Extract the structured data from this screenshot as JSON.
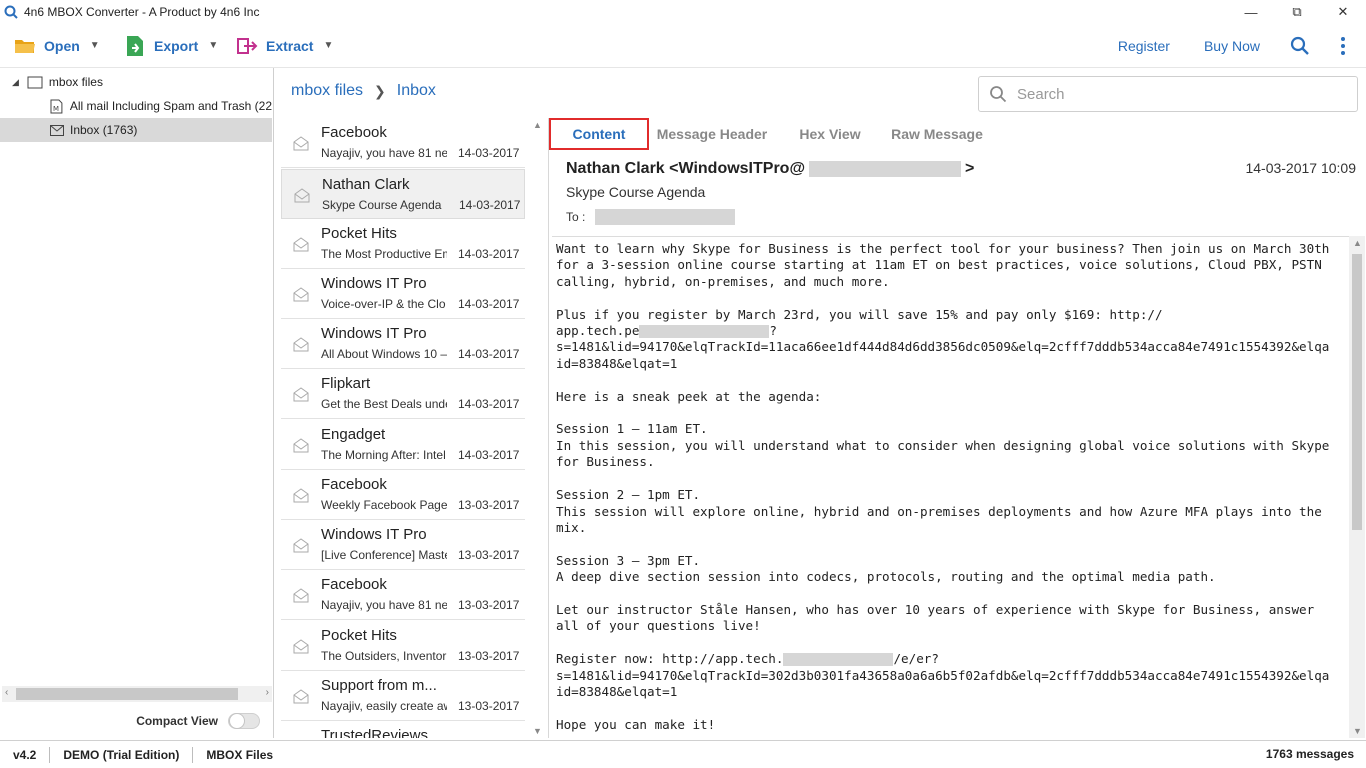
{
  "window": {
    "title": "4n6 MBOX Converter - A Product by 4n6 Inc",
    "app_icon": "magnifier-icon",
    "controls": {
      "minimize": "—",
      "restore": "⧉",
      "close": "✕"
    }
  },
  "toolbar": {
    "open_label": "Open",
    "export_label": "Export",
    "extract_label": "Extract",
    "register_label": "Register",
    "buy_label": "Buy Now"
  },
  "tree": {
    "root_label": "mbox files",
    "items": [
      {
        "label": "All mail Including Spam and Trash  (22",
        "icon": "mbox-file-icon"
      },
      {
        "label": "Inbox  (1763)",
        "icon": "envelope-icon",
        "selected": true
      }
    ]
  },
  "compact_view": {
    "label": "Compact View",
    "on": false
  },
  "breadcrumb": {
    "root": "mbox files",
    "current": "Inbox"
  },
  "search": {
    "placeholder": "Search"
  },
  "mails": [
    {
      "sender": "Facebook",
      "subject": "Nayajiv, you have 81 ne",
      "date": "14-03-2017"
    },
    {
      "sender": "Nathan Clark",
      "subject": "Skype Course Agenda",
      "date": "14-03-2017",
      "selected": true
    },
    {
      "sender": "Pocket Hits",
      "subject": "The Most Productive Em",
      "date": "14-03-2017"
    },
    {
      "sender": "Windows IT Pro",
      "subject": "Voice-over-IP & the Clo",
      "date": "14-03-2017"
    },
    {
      "sender": "Windows IT Pro",
      "subject": "All About Windows 10 –",
      "date": "14-03-2017"
    },
    {
      "sender": "Flipkart",
      "subject": "Get the Best Deals unde",
      "date": "14-03-2017"
    },
    {
      "sender": "Engadget",
      "subject": "The Morning After: Intel",
      "date": "14-03-2017"
    },
    {
      "sender": "Facebook",
      "subject": "Weekly Facebook Page (",
      "date": "13-03-2017"
    },
    {
      "sender": "Windows IT Pro",
      "subject": "[Live Conference] Maste",
      "date": "13-03-2017"
    },
    {
      "sender": "Facebook",
      "subject": "Nayajiv, you have 81 ne",
      "date": "13-03-2017"
    },
    {
      "sender": "Pocket Hits",
      "subject": "The Outsiders, Inventor",
      "date": "13-03-2017"
    },
    {
      "sender": "Support from m...",
      "subject": "Nayajiv, easily create aw",
      "date": "13-03-2017"
    },
    {
      "sender": "TrustedReviews",
      "subject": "",
      "date": ""
    }
  ],
  "tabs": [
    {
      "label": "Content",
      "active": true
    },
    {
      "label": "Message Header",
      "active": false
    },
    {
      "label": "Hex View",
      "active": false
    },
    {
      "label": "Raw Message",
      "active": false
    }
  ],
  "message": {
    "from_prefix": "Nathan Clark <WindowsITPro@",
    "from_suffix": ">",
    "date": "14-03-2017 10:09",
    "subject": "Skype Course Agenda",
    "to_label": "To :",
    "body_lines": [
      "Want to learn why Skype for Business is the perfect tool for your business? Then join us on March 30th",
      "for a 3-session online course starting at 11am ET on best practices, voice solutions, Cloud PBX, PSTN",
      "calling, hybrid, on-premises, and much more.",
      "",
      "Plus if you register by March 23rd, you will save 15% and pay only $169: http://",
      "app.tech.pe",
      "s=1481&lid=94170&elqTrackId=11aca66ee1df444d84d6dd3856dc0509&elq=2cfff7dddb534acca84e7491c1554392&elqa",
      "id=83848&elqat=1",
      "",
      "Here is a sneak peek at the agenda:",
      "",
      "Session 1 – 11am ET.",
      "In this session, you will understand what to consider when designing global voice solutions with Skype",
      "for Business.",
      "",
      "Session 2 – 1pm ET.",
      "This session will explore online, hybrid and on-premises deployments and how Azure MFA plays into the",
      "mix.",
      "",
      "Session 3 – 3pm ET.",
      "A deep dive section session into codecs, protocols, routing and the optimal media path.",
      "",
      "Let our instructor Ståle Hansen, who has over 10 years of experience with Skype for Business, answer",
      "all of your questions live!",
      "",
      "Register now: http://app.tech.",
      "s=1481&lid=94170&elqTrackId=302d3b0301fa43658a0a6a6b5f02afdb&elq=2cfff7dddb534acca84e7491c1554392&elqa",
      "id=83848&elqat=1",
      "",
      "Hope you can make it!"
    ],
    "line5_suffix": "?",
    "line25_suffix": "/e/er?"
  },
  "status": {
    "version": "v4.2",
    "edition": "DEMO (Trial Edition)",
    "type": "MBOX Files",
    "count": "1763 messages"
  },
  "colors": {
    "accent": "#2a6ebb",
    "active_tab_border": "#e12b2b"
  }
}
